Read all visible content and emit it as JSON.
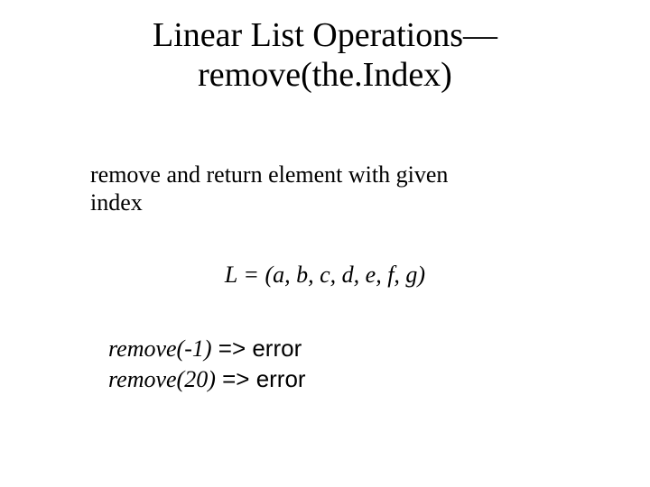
{
  "title": {
    "line1": "Linear List Operations—",
    "line2": "remove(the.Index)"
  },
  "description": {
    "line1": "remove and return element with given",
    "line2": "index"
  },
  "list_definition": "L = (a, b, c, d, e, f, g)",
  "examples": {
    "row1_call": "remove(-1)",
    "row1_result": " => error",
    "row2_call": "remove(20)",
    "row2_result": " => error"
  }
}
